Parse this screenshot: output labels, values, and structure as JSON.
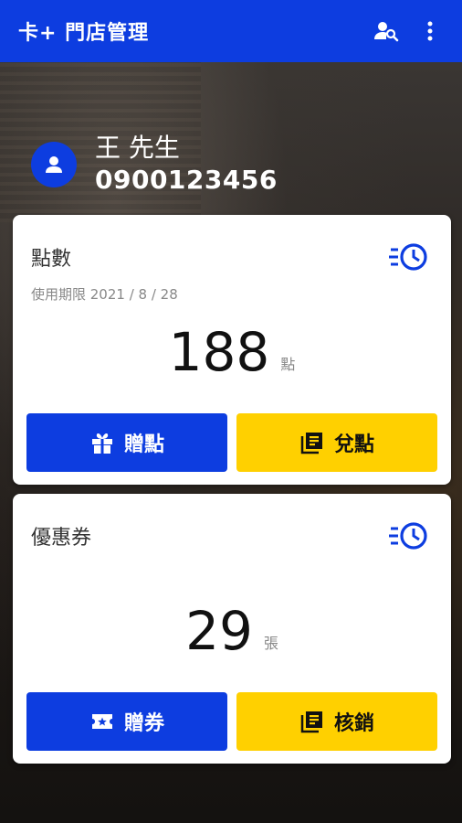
{
  "appbar": {
    "title": "卡+ 門店管理",
    "icons": [
      "person-search-icon",
      "more-vert-icon"
    ]
  },
  "user": {
    "name": "王 先生",
    "phone": "0900123456",
    "avatar_icon": "person-icon"
  },
  "points_card": {
    "title": "點數",
    "expiry": "使用期限 2021 / 8 / 28",
    "value": "188",
    "unit": "點",
    "history_icon": "history-icon",
    "buttons": [
      {
        "label": "贈點",
        "icon": "gift-icon",
        "color": "#0d3de0"
      },
      {
        "label": "兌點",
        "icon": "library-books-icon",
        "color": "#ffd000"
      }
    ]
  },
  "coupon_card": {
    "title": "優惠券",
    "value": "29",
    "unit": "張",
    "history_icon": "history-icon",
    "buttons": [
      {
        "label": "贈券",
        "icon": "ticket-icon",
        "color": "#0d3de0"
      },
      {
        "label": "核銷",
        "icon": "library-books-icon",
        "color": "#ffd000"
      }
    ]
  },
  "colors": {
    "primary": "#0d3de0",
    "accent": "#ffd000"
  }
}
